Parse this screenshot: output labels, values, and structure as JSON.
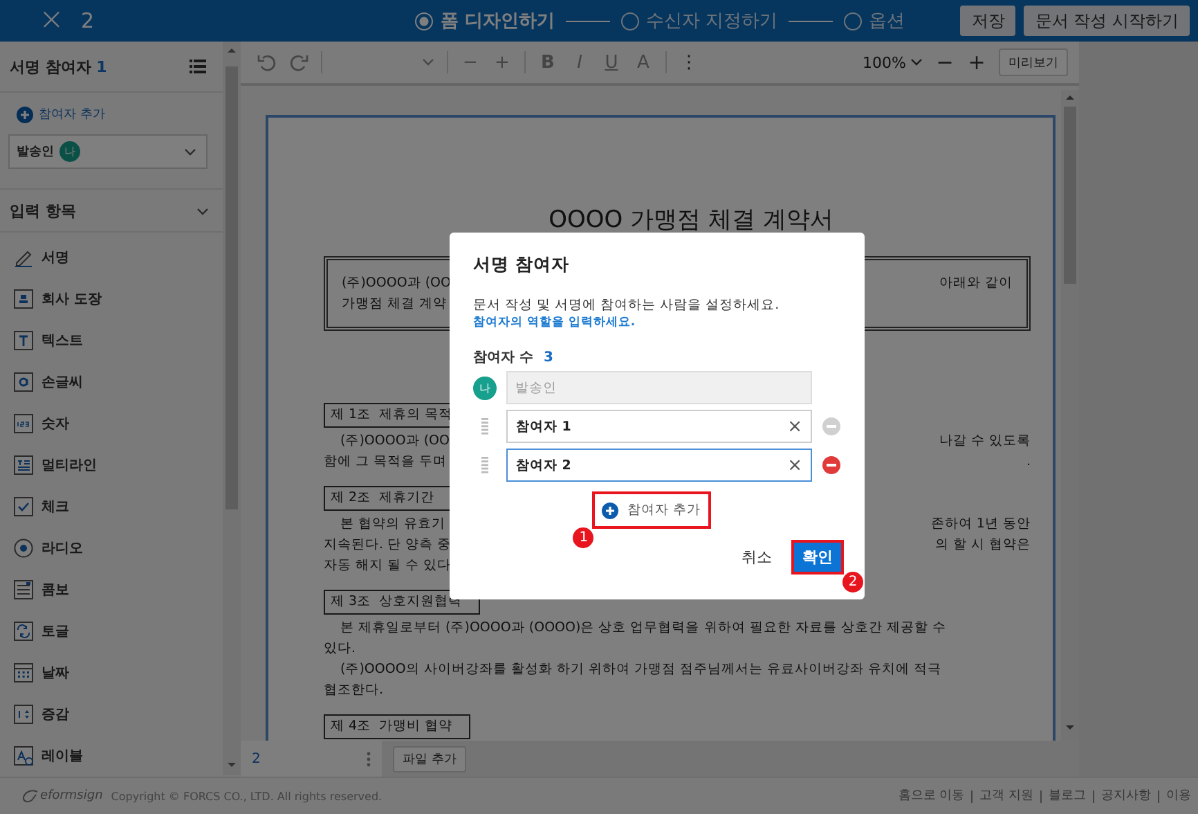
{
  "topbar": {
    "close": "×",
    "count": "2",
    "steps": [
      {
        "label": "폼 디자인하기",
        "selected": true
      },
      {
        "label": "수신자 지정하기",
        "selected": false
      },
      {
        "label": "옵션",
        "selected": false
      }
    ],
    "buttons": [
      "저장",
      "문서 작성 시작하기"
    ]
  },
  "sidebar": {
    "title": "서명 참여자",
    "count": "1",
    "add_label": "참여자 추가",
    "participant": {
      "name": "발송인",
      "badge": "나"
    },
    "section": {
      "title": "입력 항목",
      "expanded": true
    },
    "items": [
      {
        "kind": "signature",
        "label": "서명"
      },
      {
        "kind": "stamp",
        "label": "회사 도장"
      },
      {
        "kind": "text",
        "label": "텍스트"
      },
      {
        "kind": "handwriting",
        "label": "손글씨"
      },
      {
        "kind": "number",
        "label": "숫자"
      },
      {
        "kind": "multiline",
        "label": "멀티라인"
      },
      {
        "kind": "check",
        "label": "체크"
      },
      {
        "kind": "radio",
        "label": "라디오"
      },
      {
        "kind": "combo",
        "label": "콤보"
      },
      {
        "kind": "toggle",
        "label": "토글"
      },
      {
        "kind": "date",
        "label": "날짜"
      },
      {
        "kind": "stepper",
        "label": "증감"
      },
      {
        "kind": "label",
        "label": "레이블"
      }
    ]
  },
  "toolbar": {
    "tools": [
      {
        "kind": "undo",
        "disabled": true
      },
      {
        "kind": "redo",
        "disabled": true
      },
      {
        "kind": "divider"
      },
      {
        "kind": "select",
        "disabled": true
      },
      {
        "kind": "divider"
      },
      {
        "kind": "char",
        "text": "−",
        "disabled": true
      },
      {
        "kind": "char",
        "text": "+",
        "disabled": true
      },
      {
        "kind": "divider"
      },
      {
        "kind": "bold",
        "text": "B",
        "disabled": true
      },
      {
        "kind": "italic",
        "text": "I",
        "disabled": true
      },
      {
        "kind": "underline",
        "text": "U",
        "disabled": true
      },
      {
        "kind": "color",
        "text": "A",
        "disabled": true
      },
      {
        "kind": "divider"
      },
      {
        "kind": "char",
        "text": "⋮",
        "disabled": false
      }
    ],
    "zoom": "100%",
    "zoom_out": "−",
    "zoom_in": "+",
    "preview": "미리보기"
  },
  "document": [
    {
      "kind": "title",
      "text": "OOOO 가맹점 체결 계약서"
    },
    {
      "kind": "box",
      "lines": [
        {
          "left": "(주)OOOO과 (OO",
          "right": "아래와 같이",
          "indent": false
        },
        {
          "left": "가맹점 체결 계약",
          "indent": false
        }
      ]
    },
    {
      "kind": "gap"
    },
    {
      "kind": "heading",
      "text": "제 1조  제휴의 목적"
    },
    {
      "kind": "para",
      "lines": [
        {
          "left": "(주)OOOO과 (OO",
          "right": "나갈 수 있도록",
          "indent": true
        },
        {
          "left": "함에 그 목적을 두며",
          "right": ".",
          "indent": false
        }
      ]
    },
    {
      "kind": "heading",
      "text": "제 2조  제휴기간"
    },
    {
      "kind": "para",
      "lines": [
        {
          "left": "본 협약의 유효기",
          "right": "존하여 1년 동안",
          "indent": true
        },
        {
          "left": "지속된다. 단 양측 중",
          "right": "의 할 시 협약은",
          "indent": false
        },
        {
          "left": "자동 해지 될 수 있다",
          "indent": false
        }
      ]
    },
    {
      "kind": "heading",
      "text": "제 3조  상호지원협력"
    },
    {
      "kind": "para",
      "lines": [
        {
          "left": "본 제휴일로부터 (주)OOOO과 (OOOO)은 상호 업무협력을 위하여 필요한 자료를 상호간 제공할 수",
          "indent": true
        },
        {
          "left": "있다.",
          "indent": false
        },
        {
          "left": "(주)OOOO의 사이버강좌를 활성화 하기 위하여 가맹점 점주님께서는 유료사이버강좌 유치에 적극",
          "indent": true
        },
        {
          "left": "협조한다.",
          "indent": false
        }
      ]
    },
    {
      "kind": "heading",
      "text": "제 4조  가맹비 협약"
    }
  ],
  "filebar": {
    "tab": {
      "label": "2",
      "selected": true
    },
    "add_file": "파일 추가"
  },
  "footer": {
    "logo": "eformsign",
    "copyright": "Copyright © FORCS CO., LTD. All rights reserved.",
    "links": [
      "홈으로 이동",
      "고객 지원",
      "블로그",
      "공지사항",
      "이용"
    ]
  },
  "dialog": {
    "title": "서명 참여자",
    "description": "문서 작성 및 서명에 참여하는 사람을 설정하세요.",
    "hint": "참여자의 역할을 입력하세요.",
    "count_label": "참여자 수",
    "count": "3",
    "participants": [
      {
        "kind": "sender",
        "badge": "나",
        "value": "발송인",
        "disabled": true
      },
      {
        "kind": "signer",
        "value": "참여자 1",
        "clear": "×",
        "focused": false,
        "removable": false
      },
      {
        "kind": "signer",
        "value": "참여자 2",
        "clear": "×",
        "focused": true,
        "removable": true
      }
    ],
    "add_button": {
      "label": "참여자 추가",
      "callout": "1"
    },
    "cancel": "취소",
    "confirm": {
      "label": "확인",
      "callout": "2"
    }
  }
}
